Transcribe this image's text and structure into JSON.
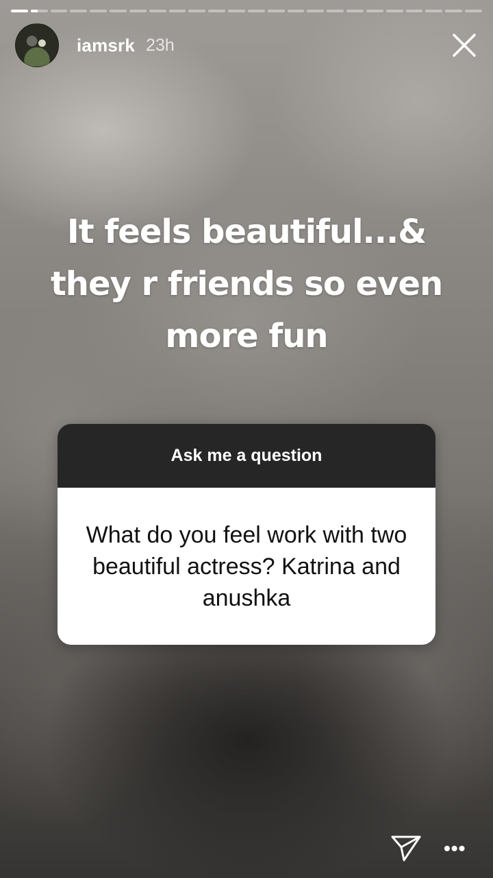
{
  "story": {
    "segment_count": 24,
    "active_segment_index": 1,
    "active_segment_progress": 0.4
  },
  "header": {
    "username": "iamsrk",
    "time": "23h"
  },
  "caption": {
    "text": "It feels beautiful...& they r friends so even more fun"
  },
  "question_card": {
    "title": "Ask me a question",
    "question": "What do you feel work with two beautiful actress? Katrina and anushka"
  },
  "footer": {
    "more_label": "•••"
  }
}
